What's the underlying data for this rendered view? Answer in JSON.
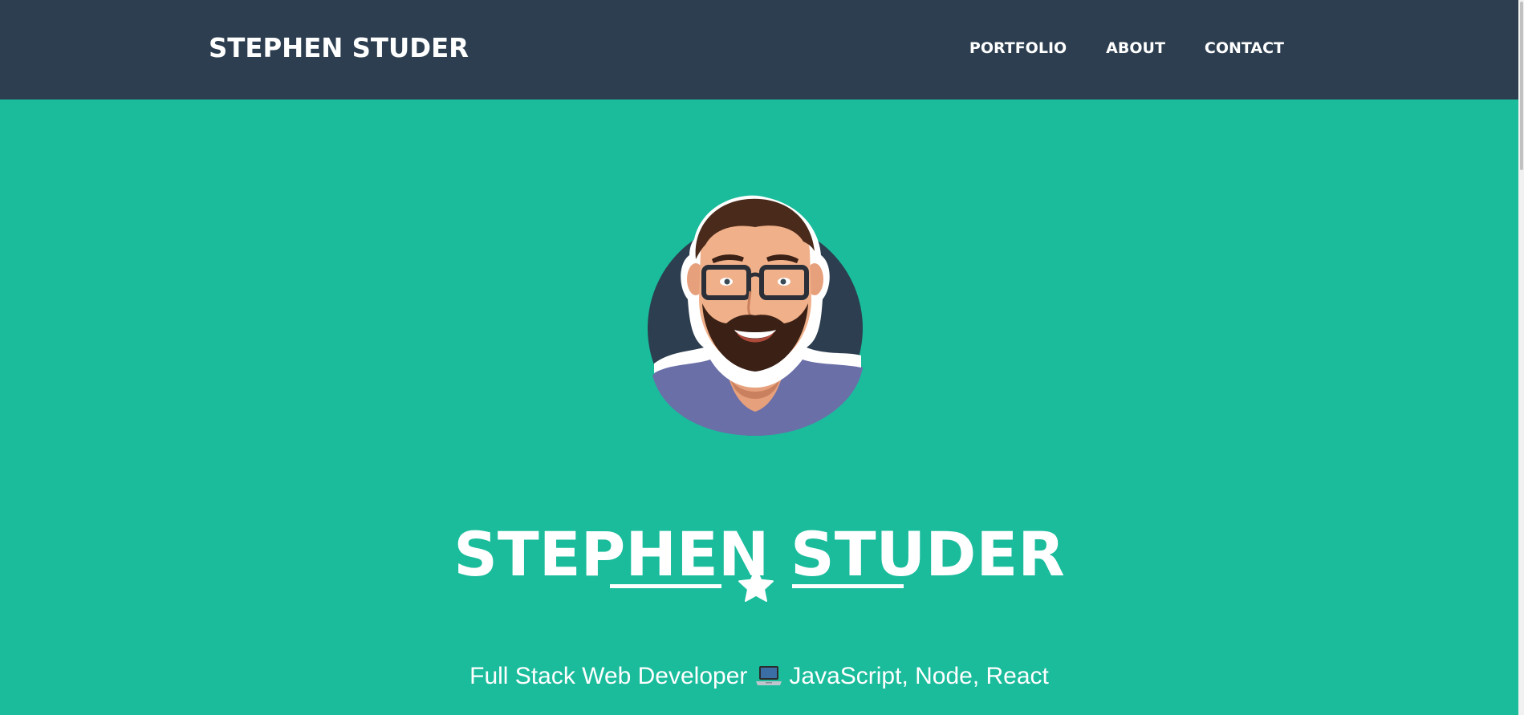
{
  "navbar": {
    "brand": "STEPHEN STUDER",
    "links": [
      {
        "label": "PORTFOLIO"
      },
      {
        "label": "ABOUT"
      },
      {
        "label": "CONTACT"
      }
    ]
  },
  "hero": {
    "avatar_icon": "developer-avatar-illustration",
    "title": "STEPHEN STUDER",
    "divider_icon": "star-icon",
    "subtitle_before": "Full Stack Web Developer",
    "subtitle_icon": "laptop-icon",
    "subtitle_after": "JavaScript, Node, React"
  },
  "colors": {
    "navbar_bg": "#2c3e50",
    "hero_bg": "#1abc9c",
    "text": "#ffffff"
  }
}
